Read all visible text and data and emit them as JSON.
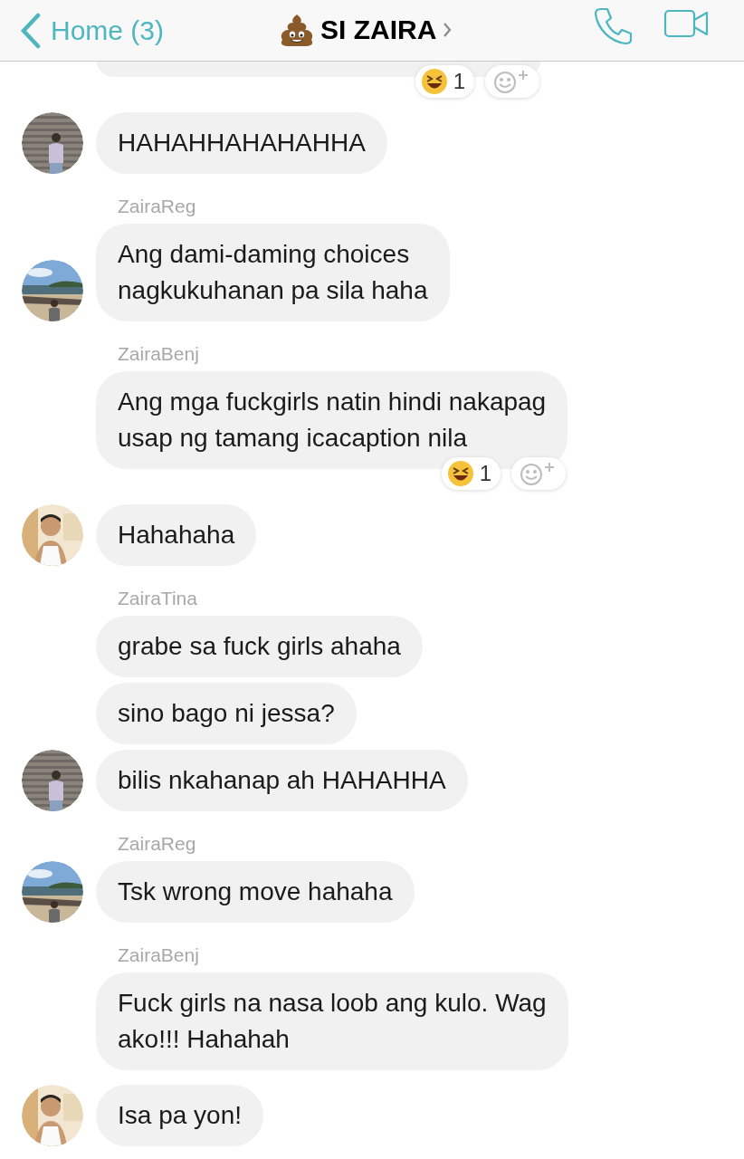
{
  "header": {
    "back_label": "Home (3)",
    "title": "SI ZAIRA"
  },
  "messages": [
    {
      "bubbles": [
        {
          "reaction_count": "1"
        }
      ]
    },
    {
      "avatar": {
        "kind": "wall"
      },
      "bubbles": [
        {
          "text": "HAHAHHAHAHAHHA"
        }
      ]
    },
    {
      "sender": "ZairaReg",
      "avatar": {
        "kind": "beach"
      },
      "bubbles": [
        {
          "text": "Ang dami-daming choices\nnagkukuhanan pa sila haha"
        }
      ]
    },
    {
      "sender": "ZairaBenj",
      "bubbles": [
        {
          "text": "Ang mga fuckgirls natin hindi nakapag\nusap ng tamang icacaption nila",
          "reaction_count": "1"
        }
      ]
    },
    {
      "avatar": {
        "kind": "room"
      },
      "bubbles": [
        {
          "text": "Hahahaha"
        }
      ]
    },
    {
      "sender": "ZairaTina",
      "avatar": {
        "kind": "wall"
      },
      "bubbles": [
        {
          "text": "grabe sa fuck girls ahaha"
        },
        {
          "text": "sino bago ni jessa?"
        },
        {
          "text": "bilis nkahanap ah HAHAHHA"
        }
      ]
    },
    {
      "sender": "ZairaReg",
      "avatar": {
        "kind": "beach"
      },
      "bubbles": [
        {
          "text": "Tsk wrong move hahaha"
        }
      ]
    },
    {
      "sender": "ZairaBenj",
      "bubbles": [
        {
          "text": "Fuck girls na nasa loob ang kulo. Wag\nako!!! Hahahah"
        }
      ]
    },
    {
      "avatar": {
        "kind": "room"
      },
      "bubbles": [
        {
          "text": "Isa pa yon!"
        }
      ]
    }
  ]
}
